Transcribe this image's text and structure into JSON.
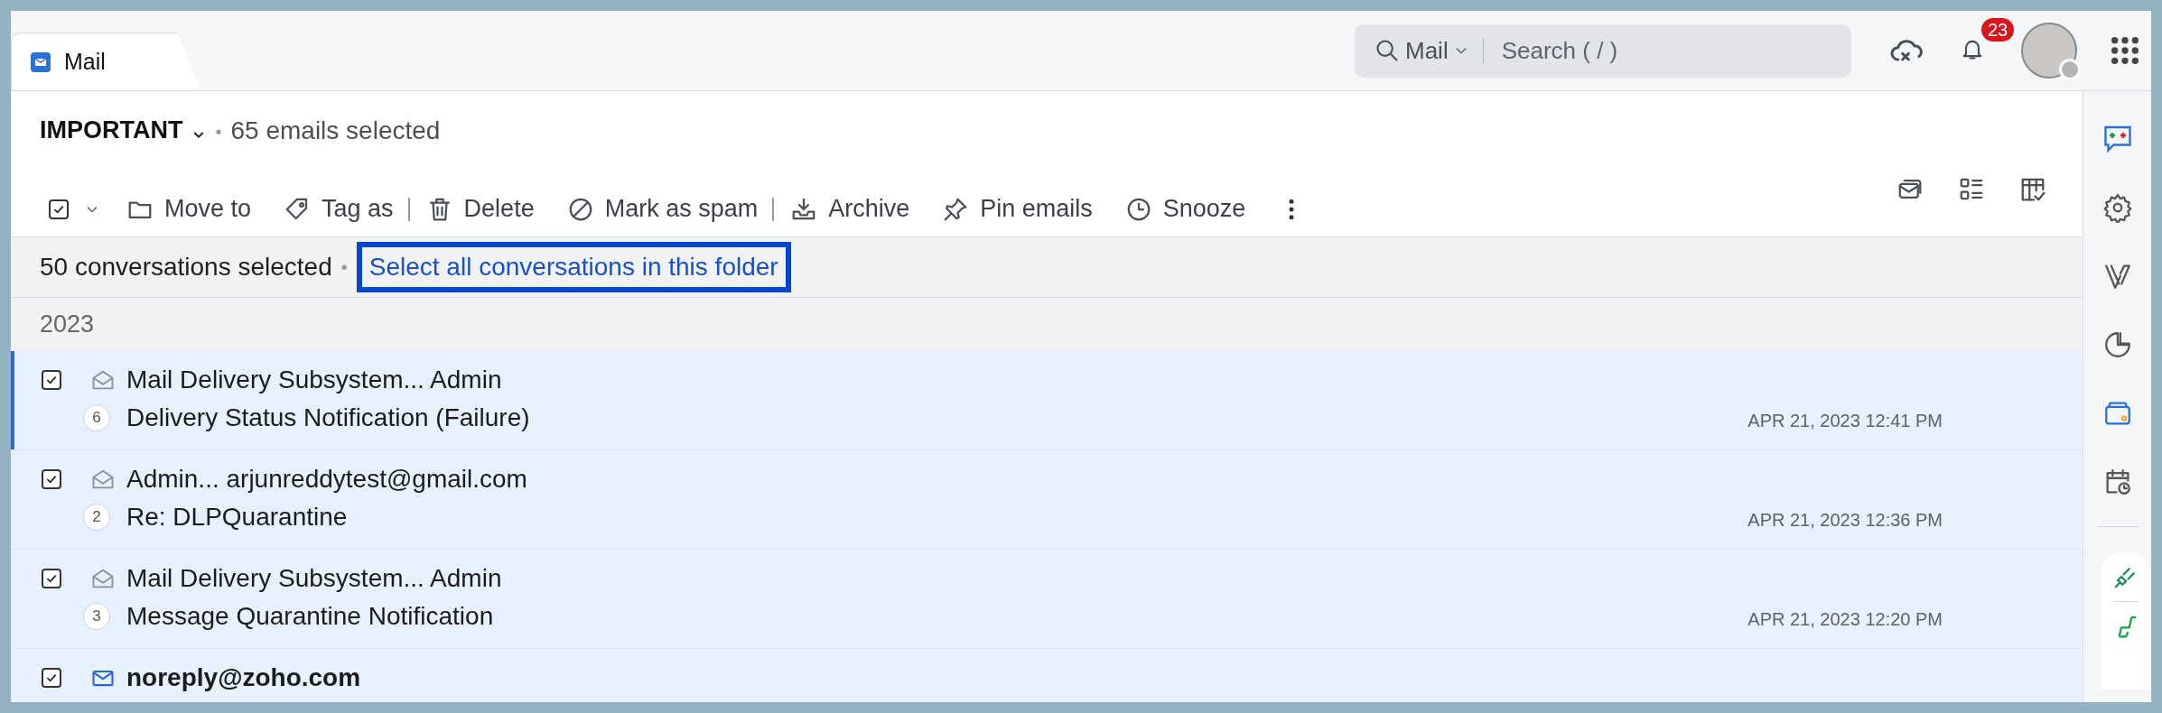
{
  "app_tab": {
    "label": "Mail",
    "selected": true
  },
  "search": {
    "scope": "Mail",
    "placeholder": "Search ( / )"
  },
  "notifications": {
    "count": "23"
  },
  "folder": {
    "title": "IMPORTANT",
    "separator": "•",
    "summary": "65 emails selected"
  },
  "select_all": {
    "checked": true
  },
  "toolbar": [
    {
      "kind": "move",
      "label": "Move to"
    },
    {
      "kind": "tag",
      "label": "Tag as"
    },
    {
      "kind": "separator"
    },
    {
      "kind": "delete",
      "label": "Delete"
    },
    {
      "kind": "spam",
      "label": "Mark as spam"
    },
    {
      "kind": "separator"
    },
    {
      "kind": "archive",
      "label": "Archive"
    },
    {
      "kind": "pin",
      "label": "Pin emails"
    },
    {
      "kind": "snooze",
      "label": "Snooze"
    },
    {
      "kind": "more"
    }
  ],
  "selection_bar": {
    "text": "50 conversations selected",
    "separator": "•",
    "link": "Select all conversations in this folder",
    "highlighted": true
  },
  "group": {
    "label": "2023"
  },
  "emails": [
    {
      "from": "Mail Delivery Subsystem... Admin",
      "subject": "Delivery Status Notification (Failure)",
      "count": "6",
      "date": "APR 21, 2023 12:41 PM",
      "checked": true,
      "unread": false,
      "focused": true
    },
    {
      "from": "Admin... arjunreddytest@gmail.com",
      "subject": "Re: DLPQuarantine",
      "count": "2",
      "date": "APR 21, 2023 12:36 PM",
      "checked": true,
      "unread": false,
      "focused": false
    },
    {
      "from": "Mail Delivery Subsystem... Admin",
      "subject": "Message Quarantine Notification",
      "count": "3",
      "date": "APR 21, 2023 12:20 PM",
      "checked": true,
      "unread": false,
      "focused": false
    },
    {
      "from": "noreply@zoho.com",
      "checked": true,
      "unread": true,
      "focused": false
    }
  ]
}
